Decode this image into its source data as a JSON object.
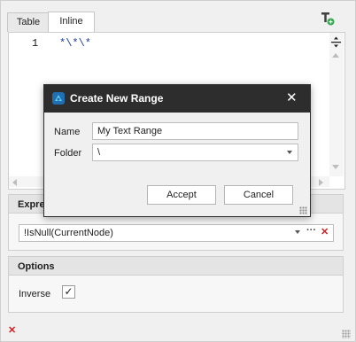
{
  "tabs": [
    {
      "label": "Table",
      "active": false
    },
    {
      "label": "Inline",
      "active": true
    }
  ],
  "editor": {
    "line_number": "1",
    "code": "*\\*\\*"
  },
  "expression_group": {
    "header": "Expre",
    "value": "!IsNull(CurrentNode)",
    "ellipsis": "···",
    "clear": "✕"
  },
  "options_group": {
    "header": "Options",
    "inverse_label": "Inverse",
    "inverse_checked": true,
    "check_glyph": "✓"
  },
  "footer": {
    "clear": "✕"
  },
  "dialog": {
    "title": "Create New Range",
    "close_glyph": "✕",
    "name_label": "Name",
    "name_value": "My Text Range",
    "folder_label": "Folder",
    "folder_value": "\\",
    "accept_label": "Accept",
    "cancel_label": "Cancel"
  },
  "icons": [
    "add-column-icon",
    "split-editor-icon",
    "app-logo-icon",
    "close-icon",
    "chevron-down-icon",
    "checkmark-icon",
    "clear-icon"
  ],
  "colors": {
    "title_bar": "#2d2d2d",
    "code_text": "#1b3fa0",
    "clear_red": "#d02020",
    "accent_green": "#3aa655"
  }
}
